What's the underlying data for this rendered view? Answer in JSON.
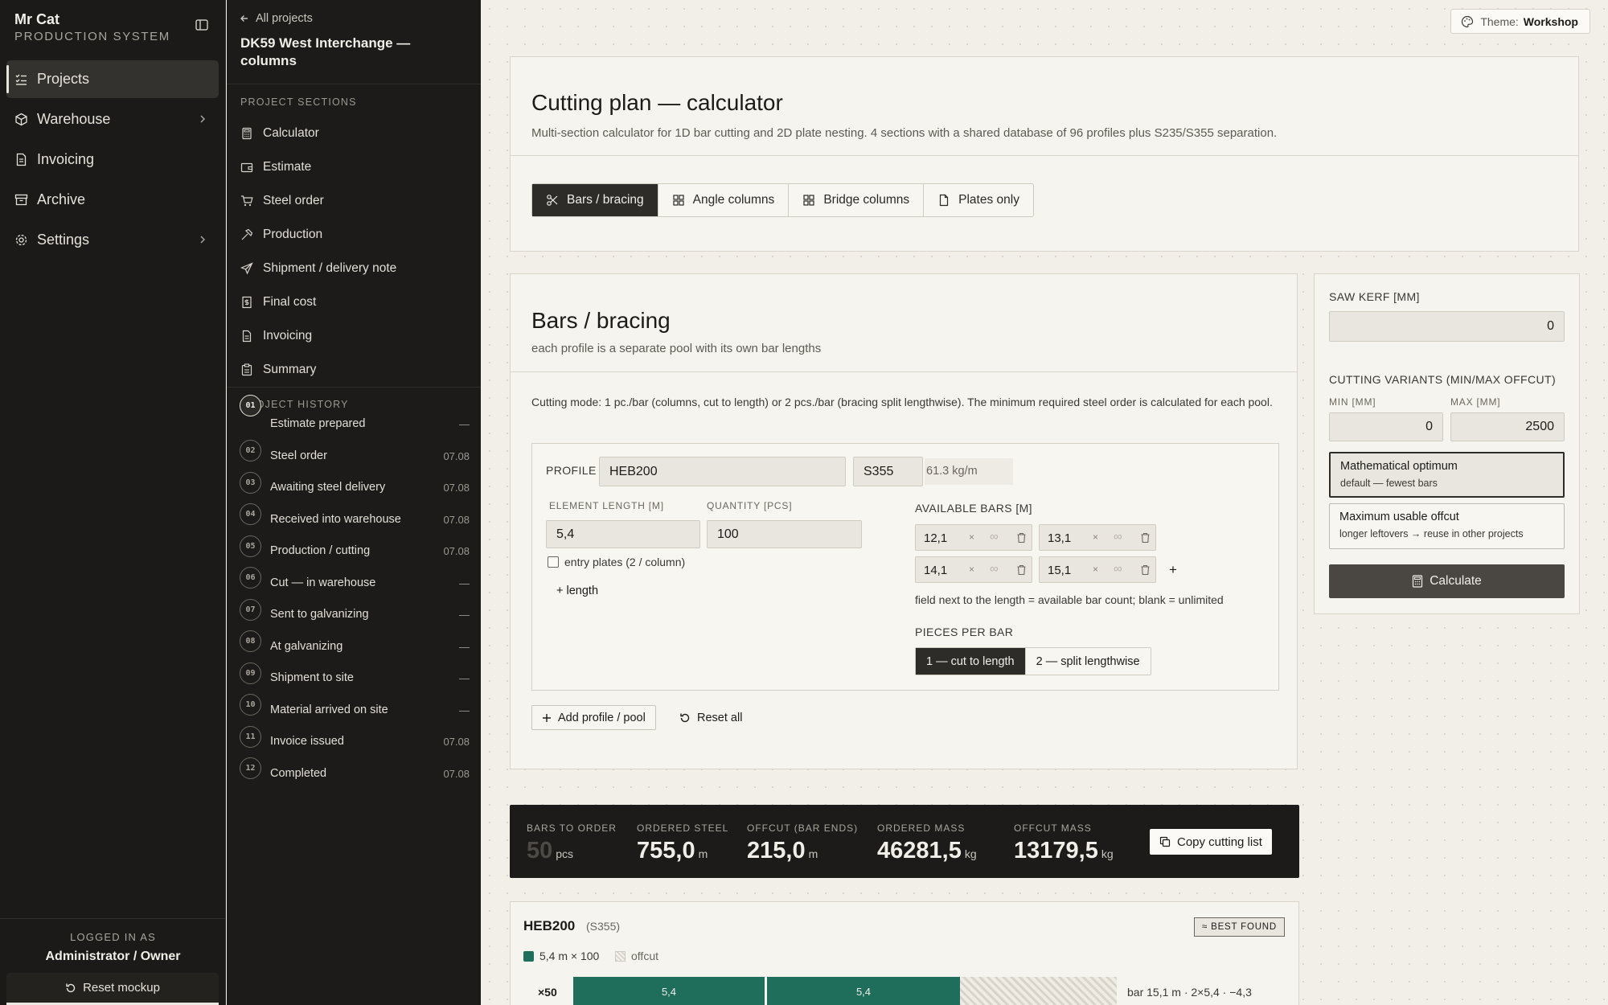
{
  "brand": {
    "name": "Mr Cat",
    "subtitle": "PRODUCTION SYSTEM"
  },
  "nav": {
    "items": [
      {
        "label": "Projects",
        "icon": "list-check-icon",
        "active": true
      },
      {
        "label": "Warehouse",
        "icon": "box-icon",
        "expandable": true
      },
      {
        "label": "Invoicing",
        "icon": "document-icon"
      },
      {
        "label": "Archive",
        "icon": "archive-icon"
      },
      {
        "label": "Settings",
        "icon": "gear-icon",
        "expandable": true
      }
    ]
  },
  "footer": {
    "logged_label": "LOGGED IN AS",
    "user": "Administrator / Owner",
    "reset_label": "Reset mockup"
  },
  "project": {
    "back_label": "All projects",
    "title": "DK59 West Interchange — columns",
    "sections_label": "PROJECT SECTIONS",
    "sections": [
      {
        "label": "Calculator",
        "icon": "calculator-icon"
      },
      {
        "label": "Estimate",
        "icon": "wallet-icon"
      },
      {
        "label": "Steel order",
        "icon": "cart-icon"
      },
      {
        "label": "Production",
        "icon": "hammer-icon"
      },
      {
        "label": "Shipment / delivery note",
        "icon": "send-icon"
      },
      {
        "label": "Final cost",
        "icon": "dollar-document-icon"
      },
      {
        "label": "Invoicing",
        "icon": "document-icon"
      },
      {
        "label": "Summary",
        "icon": "clipboard-icon"
      }
    ],
    "history_label": "PROJECT HISTORY",
    "history": [
      {
        "num": "01",
        "label": "Estimate prepared",
        "date": "—"
      },
      {
        "num": "02",
        "label": "Steel order",
        "date": "07.08"
      },
      {
        "num": "03",
        "label": "Awaiting steel delivery",
        "date": "07.08"
      },
      {
        "num": "04",
        "label": "Received into warehouse",
        "date": "07.08"
      },
      {
        "num": "05",
        "label": "Production / cutting",
        "date": "07.08"
      },
      {
        "num": "06",
        "label": "Cut — in warehouse",
        "date": "—"
      },
      {
        "num": "07",
        "label": "Sent to galvanizing",
        "date": "—"
      },
      {
        "num": "08",
        "label": "At galvanizing",
        "date": "—"
      },
      {
        "num": "09",
        "label": "Shipment to site",
        "date": "—"
      },
      {
        "num": "10",
        "label": "Material arrived on site",
        "date": "—"
      },
      {
        "num": "11",
        "label": "Invoice issued",
        "date": "07.08"
      },
      {
        "num": "12",
        "label": "Completed",
        "date": "07.08"
      }
    ]
  },
  "theme": {
    "label": "Theme:",
    "value": "Workshop"
  },
  "header": {
    "title": "Cutting plan — calculator",
    "subtitle": "Multi-section calculator for 1D bar cutting and 2D plate nesting. 4 sections with a shared database of 96 profiles plus S235/S355 separation.",
    "tabs": [
      {
        "label": "Bars / bracing",
        "icon": "scissors-icon",
        "active": true
      },
      {
        "label": "Angle columns",
        "icon": "grid-icon"
      },
      {
        "label": "Bridge columns",
        "icon": "grid-icon"
      },
      {
        "label": "Plates only",
        "icon": "file-icon"
      }
    ]
  },
  "bars": {
    "title": "Bars / bracing",
    "subtitle": "each profile is a separate pool with its own bar lengths",
    "mode_text": "Cutting mode: 1 pc./bar (columns, cut to length) or 2 pcs./bar (bracing split lengthwise). The minimum required steel order is calculated for each pool.",
    "profile_label": "PROFILE",
    "profile_value": "HEB200",
    "grade_value": "S355",
    "mass_per_m": "61.3 kg/m",
    "length_label": "ELEMENT LENGTH [M]",
    "length_value": "5,4",
    "qty_label": "QUANTITY [PCS]",
    "qty_value": "100",
    "entry_plates_label": "entry plates (2 / column)",
    "add_length_label": "+ length",
    "available_label": "AVAILABLE BARS [M]",
    "available": [
      {
        "length": "12,1",
        "x": "×",
        "count": "∞"
      },
      {
        "length": "13,1",
        "x": "×",
        "count": "∞"
      },
      {
        "length": "14,1",
        "x": "×",
        "count": "∞"
      },
      {
        "length": "15,1",
        "x": "×",
        "count": "∞"
      }
    ],
    "add_bar_label": "+",
    "hint": "field next to the length = available bar count; blank = unlimited",
    "pieces_label": "PIECES PER BAR",
    "pieces_options": [
      "1 — cut to length",
      "2 — split lengthwise"
    ],
    "add_profile_label": "Add profile / pool",
    "reset_all_label": "Reset all"
  },
  "settings": {
    "kerf_label": "SAW KERF [MM]",
    "kerf_value": "0",
    "variants_label": "CUTTING VARIANTS (MIN/MAX OFFCUT)",
    "min_label": "MIN [MM]",
    "min_value": "0",
    "max_label": "MAX [MM]",
    "max_value": "2500",
    "options": [
      {
        "title": "Mathematical optimum",
        "desc": "default — fewest bars",
        "selected": true
      },
      {
        "title": "Maximum usable offcut",
        "desc": "longer leftovers → reuse in other projects",
        "selected": false
      }
    ],
    "calculate_label": "Calculate"
  },
  "summary": {
    "bars_label": "BARS TO ORDER",
    "bars_value": "50",
    "bars_unit": "pcs",
    "steel_label": "ORDERED STEEL",
    "steel_value": "755,0",
    "steel_unit": "m",
    "offcut_label": "OFFCUT (BAR ENDS)",
    "offcut_value": "215,0",
    "offcut_unit": "m",
    "mass_label": "ORDERED MASS",
    "mass_value": "46281,5",
    "mass_unit": "kg",
    "offmass_label": "OFFCUT MASS",
    "offmass_value": "13179,5",
    "offmass_unit": "kg",
    "copy_label": "Copy cutting list"
  },
  "result": {
    "profile": "HEB200",
    "grade": "(S355)",
    "badge": "≈ BEST FOUND",
    "legend_piece": "5,4 m × 100",
    "legend_offcut": "offcut",
    "row_multiplier": "×50",
    "pieces": [
      "5,4",
      "5,4"
    ],
    "row_note": "bar 15,1 m · 2×5,4 · −4,3",
    "colors": {
      "piece": "#1f6e5c",
      "offcut_hatch": "#d8d4ca"
    }
  }
}
